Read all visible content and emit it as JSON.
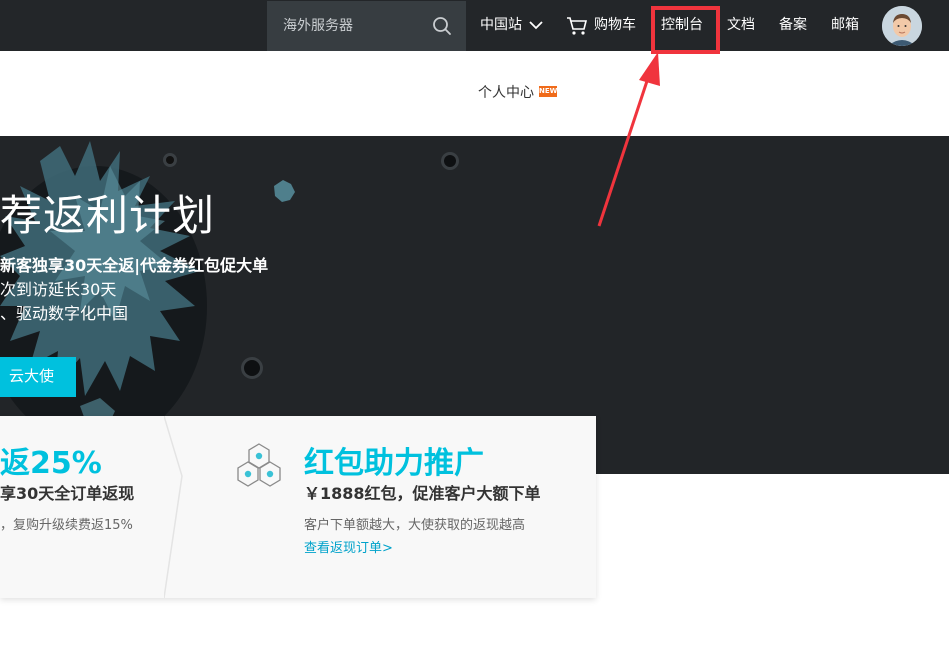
{
  "topbar": {
    "search": {
      "placeholder": "海外服务器"
    },
    "nav": {
      "region": "中国站",
      "cart": "购物车",
      "console": "控制台",
      "docs": "文档",
      "filing": "备案",
      "mail": "邮箱"
    },
    "icons": {
      "search": "search-icon",
      "chevron": "chevron-down-icon",
      "cart": "cart-icon",
      "avatar": "avatar"
    },
    "highlight_color": "#f0343d"
  },
  "subnav": {
    "personal_center": "个人中心",
    "badge": "NEW",
    "badge_color": "#f06b1a"
  },
  "banner": {
    "title": "荐返利计划",
    "line1": "新客独享30天全返|代金券红包促大单",
    "line2": "次到访延长30天",
    "line3": "、驱动数字化中国",
    "button": "云大使",
    "accent": "#00c1de"
  },
  "cards": [
    {
      "title": "返25%",
      "subtitle": "享30天全订单返现",
      "desc": "，复购升级续费返15%"
    },
    {
      "title": "红包助力推广",
      "subtitle": "￥1888红包，促准客户大额下单",
      "desc": "客户下单额越大，大使获取的返现越高",
      "link": "查看返现订单>",
      "icon": "cubes-icon"
    }
  ]
}
